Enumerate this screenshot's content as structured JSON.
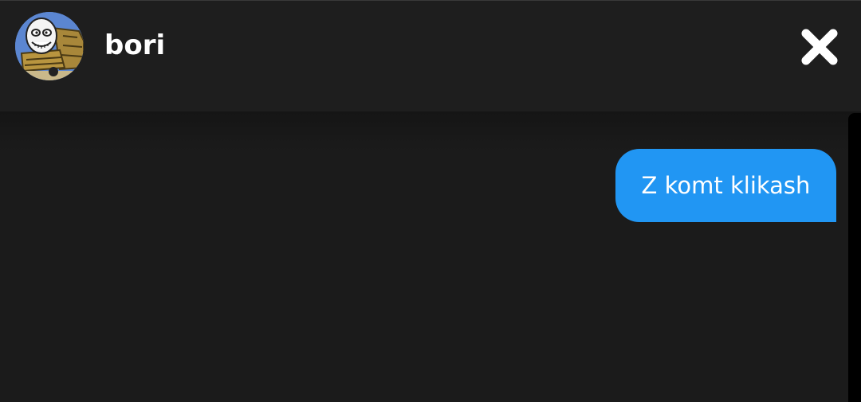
{
  "header": {
    "username": "bori",
    "avatar_icon": "cartoon-face-avatar",
    "close_icon": "close-icon"
  },
  "messages": [
    {
      "text": "Z komt klikash",
      "from": "self",
      "color": "#2196f3"
    }
  ],
  "colors": {
    "background": "#1b1b1b",
    "header_background": "#1e1e1e",
    "bubble": "#2196f3",
    "text": "#ffffff"
  }
}
